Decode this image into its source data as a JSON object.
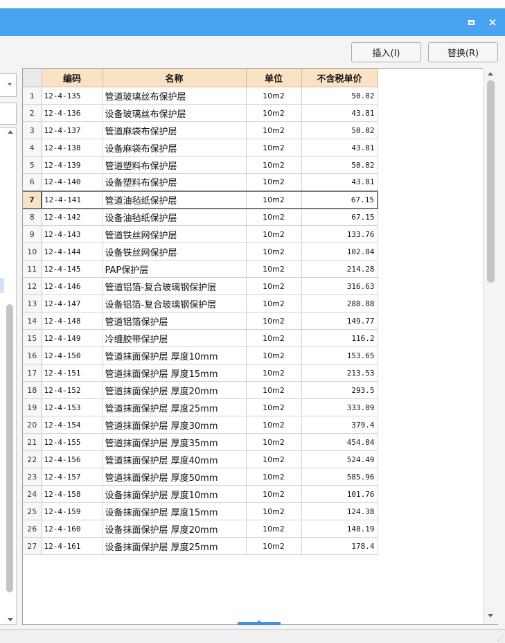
{
  "window": {
    "maximize_icon": "maximize-icon",
    "close_icon": "close-icon",
    "close_glyph": "×"
  },
  "toolbar": {
    "insert_label": "插入(I)",
    "replace_label": "替换(R)"
  },
  "grid": {
    "columns": [
      "编码",
      "名称",
      "单位",
      "不含税单价"
    ],
    "active_row": 7,
    "rows": [
      {
        "no": "1",
        "code": "12-4-135",
        "name": "管道玻璃丝布保护层",
        "unit": "10m2",
        "price": "50.02"
      },
      {
        "no": "2",
        "code": "12-4-136",
        "name": "设备玻璃丝布保护层",
        "unit": "10m2",
        "price": "43.81"
      },
      {
        "no": "3",
        "code": "12-4-137",
        "name": "管道麻袋布保护层",
        "unit": "10m2",
        "price": "50.02"
      },
      {
        "no": "4",
        "code": "12-4-138",
        "name": "设备麻袋布保护层",
        "unit": "10m2",
        "price": "43.81"
      },
      {
        "no": "5",
        "code": "12-4-139",
        "name": "管道塑料布保护层",
        "unit": "10m2",
        "price": "50.02"
      },
      {
        "no": "6",
        "code": "12-4-140",
        "name": "设备塑料布保护层",
        "unit": "10m2",
        "price": "43.81"
      },
      {
        "no": "7",
        "code": "12-4-141",
        "name": "管道油毡纸保护层",
        "unit": "10m2",
        "price": "67.15"
      },
      {
        "no": "8",
        "code": "12-4-142",
        "name": "设备油毡纸保护层",
        "unit": "10m2",
        "price": "67.15"
      },
      {
        "no": "9",
        "code": "12-4-143",
        "name": "管道铁丝网保护层",
        "unit": "10m2",
        "price": "133.76"
      },
      {
        "no": "10",
        "code": "12-4-144",
        "name": "设备铁丝网保护层",
        "unit": "10m2",
        "price": "102.84"
      },
      {
        "no": "11",
        "code": "12-4-145",
        "name": "PAP保护层",
        "unit": "10m2",
        "price": "214.28"
      },
      {
        "no": "12",
        "code": "12-4-146",
        "name": "管道铝箔-复合玻璃钢保护层",
        "unit": "10m2",
        "price": "316.63"
      },
      {
        "no": "13",
        "code": "12-4-147",
        "name": "设备铝箔-复合玻璃钢保护层",
        "unit": "10m2",
        "price": "288.88"
      },
      {
        "no": "14",
        "code": "12-4-148",
        "name": "管道铝箔保护层",
        "unit": "10m2",
        "price": "149.77"
      },
      {
        "no": "15",
        "code": "12-4-149",
        "name": "冷缠胶带保护层",
        "unit": "10m2",
        "price": "116.2"
      },
      {
        "no": "16",
        "code": "12-4-150",
        "name": "管道抹面保护层 厚度10mm",
        "unit": "10m2",
        "price": "153.65"
      },
      {
        "no": "17",
        "code": "12-4-151",
        "name": "管道抹面保护层 厚度15mm",
        "unit": "10m2",
        "price": "213.53"
      },
      {
        "no": "18",
        "code": "12-4-152",
        "name": "管道抹面保护层 厚度20mm",
        "unit": "10m2",
        "price": "293.5"
      },
      {
        "no": "19",
        "code": "12-4-153",
        "name": "管道抹面保护层 厚度25mm",
        "unit": "10m2",
        "price": "333.09"
      },
      {
        "no": "20",
        "code": "12-4-154",
        "name": "管道抹面保护层 厚度30mm",
        "unit": "10m2",
        "price": "379.4"
      },
      {
        "no": "21",
        "code": "12-4-155",
        "name": "管道抹面保护层 厚度35mm",
        "unit": "10m2",
        "price": "454.04"
      },
      {
        "no": "22",
        "code": "12-4-156",
        "name": "管道抹面保护层 厚度40mm",
        "unit": "10m2",
        "price": "524.49"
      },
      {
        "no": "23",
        "code": "12-4-157",
        "name": "管道抹面保护层 厚度50mm",
        "unit": "10m2",
        "price": "585.96"
      },
      {
        "no": "24",
        "code": "12-4-158",
        "name": "设备抹面保护层 厚度10mm",
        "unit": "10m2",
        "price": "101.76"
      },
      {
        "no": "25",
        "code": "12-4-159",
        "name": "设备抹面保护层 厚度15mm",
        "unit": "10m2",
        "price": "124.38"
      },
      {
        "no": "26",
        "code": "12-4-160",
        "name": "设备抹面保护层 厚度20mm",
        "unit": "10m2",
        "price": "148.19"
      },
      {
        "no": "27",
        "code": "12-4-161",
        "name": "设备抹面保护层 厚度25mm",
        "unit": "10m2",
        "price": "178.4"
      }
    ]
  },
  "colors": {
    "titlebar": "#4aa3f0",
    "header": "#fae3c4",
    "splitter": "#3d8fe0"
  }
}
